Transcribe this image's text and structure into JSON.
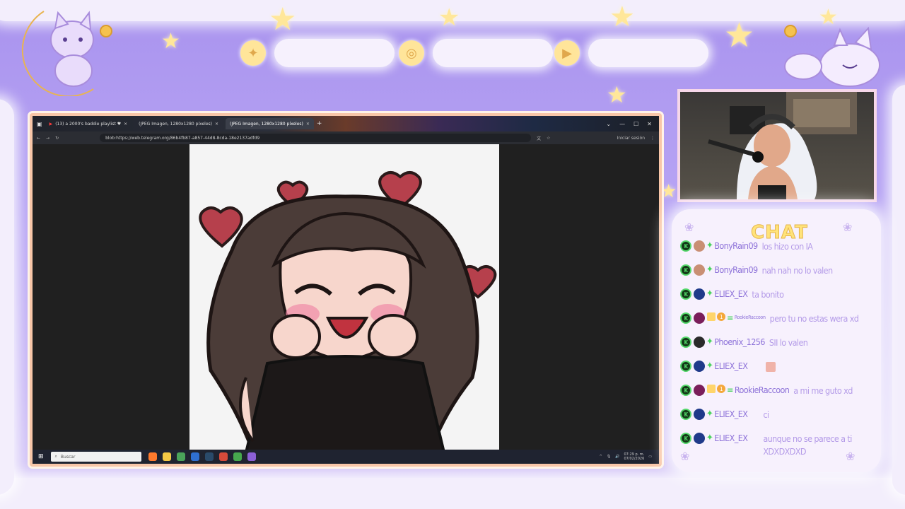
{
  "browser": {
    "tabs": [
      {
        "label": "(13) a 2000's baddie playlist ♥",
        "active": false
      },
      {
        "label": "(JPEG Imagen, 1280x1280 píxeles)",
        "active": false
      },
      {
        "label": "(JPEG Imagen, 1280x1280 píxeles)",
        "active": true
      }
    ],
    "url": "blob:https://web.telegram.org/86b4fb87-a857-44d8-8cda-18e2137adfd9",
    "signin_label": "Iniciar sesión"
  },
  "taskbar": {
    "search_placeholder": "Buscar",
    "time": "07:29 p. m.",
    "date": "07/02/2026"
  },
  "chat": {
    "title": "CHAT",
    "messages": [
      {
        "user": "BonyRain09",
        "text": "los hizo con IA",
        "sub": false,
        "small": false
      },
      {
        "user": "BonyRain09",
        "text": "nah nah no lo valen",
        "sub": false,
        "small": false
      },
      {
        "user": "ELIEX_EX",
        "text": "ta bonito",
        "sub": false,
        "small": false
      },
      {
        "user": "RookieRaccoon",
        "text": "pero tu no estas wera xd",
        "sub": true,
        "sub_months": "1",
        "small": true
      },
      {
        "user": "Phoenix_1256",
        "text": "SII lo valen",
        "sub": false,
        "small": false
      },
      {
        "user": "ELIEX_EX",
        "text": "",
        "sub": false,
        "small": false,
        "emote": true
      },
      {
        "user": "RookieRaccoon",
        "text": "a mi me guto xd",
        "sub": true,
        "sub_months": "1",
        "small": false
      },
      {
        "user": "ELIEX_EX",
        "text": "ci",
        "sub": false,
        "small": false
      },
      {
        "user": "ELIEX_EX",
        "text": "aunque no se parece a ti XDXDXDXD",
        "sub": false,
        "small": false
      }
    ]
  },
  "colors": {
    "accent": "#ffe37a",
    "chat_text": "#b49be8",
    "badge_green": "#53d769",
    "frame_border": "#f8c6a8"
  },
  "icons": [
    "twitter-icon",
    "instagram-icon",
    "youtube-icon",
    "cat-moon-mascot",
    "cat-mascot"
  ]
}
